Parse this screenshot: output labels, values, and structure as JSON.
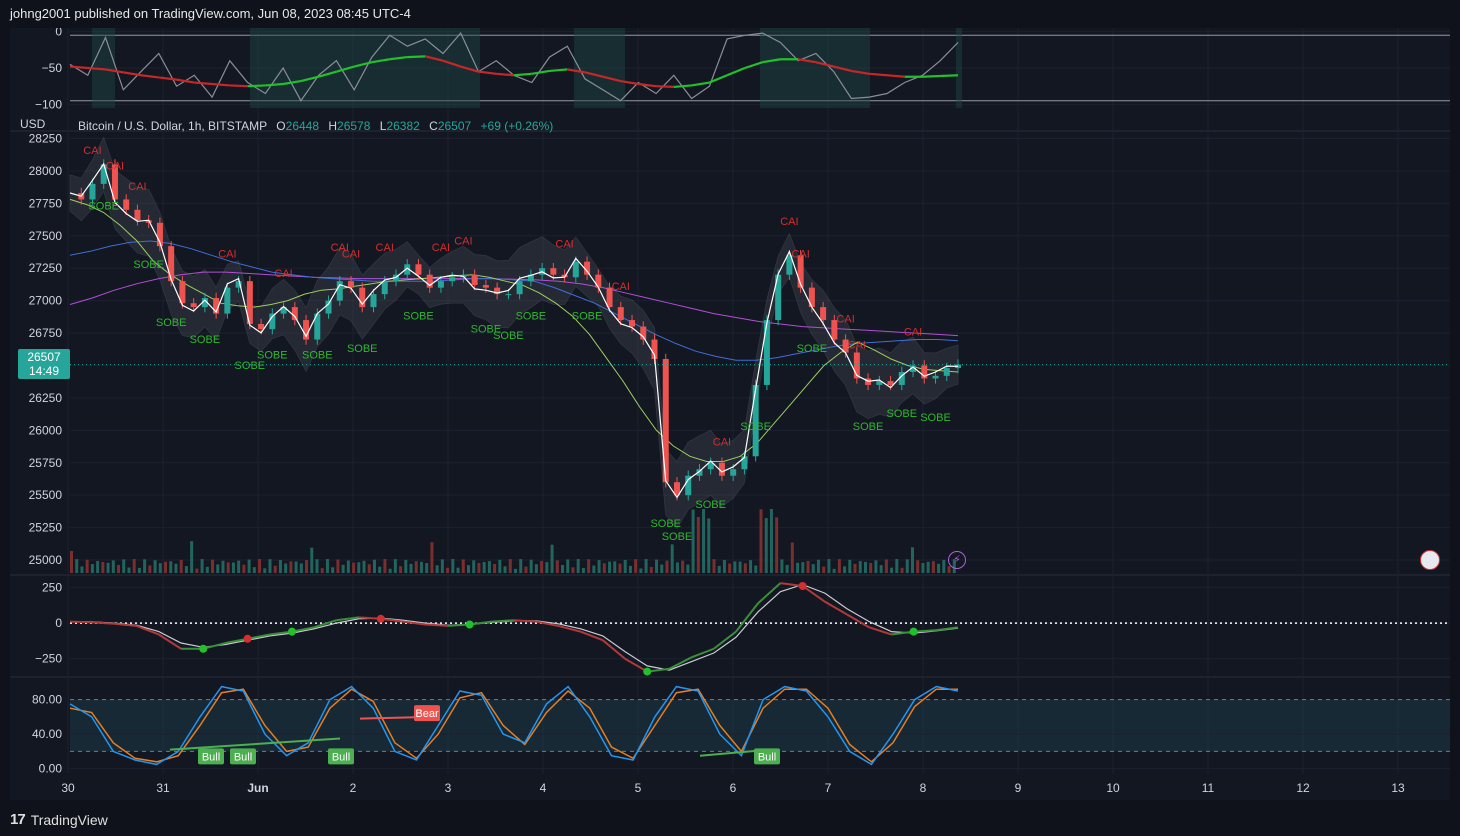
{
  "publisher": "johng2001 published on TradingView.com, Jun 08, 2023 08:45 UTC-4",
  "footer": {
    "brand": "TradingView",
    "logo": "17"
  },
  "symbol": {
    "currency": "USD",
    "name": "Bitcoin / U.S. Dollar, 1h, BITSTAMP",
    "open_label": "O",
    "open": "26448",
    "high_label": "H",
    "high": "26578",
    "low_label": "L",
    "low": "26382",
    "close_label": "C",
    "close": "26507",
    "change": "+69 (+0.26%)"
  },
  "last_price": {
    "price": "26507",
    "countdown": "14:49"
  },
  "colors": {
    "up": "#26a69a",
    "down": "#ef5350",
    "bg": "#131722",
    "grid": "#1e2230"
  },
  "icons": [
    "tradingview-logo-icon",
    "lightning-icon",
    "us-flag-icon"
  ],
  "chart_data": [
    {
      "type": "line",
      "panel": "top-oscillator",
      "yticks": [
        "0",
        "−50",
        "−100"
      ],
      "ylim": [
        -105,
        5
      ],
      "x": [
        0,
        4,
        8,
        12,
        16,
        20,
        24,
        28,
        32,
        36,
        40,
        44,
        48,
        52,
        56,
        60,
        64,
        68,
        72,
        76,
        80,
        84,
        88,
        92,
        96,
        100,
        104,
        108,
        112,
        116,
        120,
        124,
        128,
        132,
        136,
        140,
        144,
        148,
        152,
        156,
        160,
        164,
        168,
        172,
        176,
        180,
        184,
        188,
        192,
        196,
        200
      ],
      "series": [
        {
          "name": "",
          "values": [
            -45,
            -60,
            -8,
            -80,
            -55,
            -30,
            -75,
            -60,
            -90,
            -40,
            -70,
            -85,
            -50,
            -95,
            -60,
            -40,
            -80,
            -35,
            -5,
            -20,
            -10,
            -30,
            -2,
            -55,
            -40,
            -60,
            -70,
            -35,
            -20,
            -65,
            -80,
            -95,
            -70,
            -85,
            -60,
            -92,
            -75,
            -10,
            -5,
            -2,
            -15,
            -40,
            -30,
            -55,
            -92,
            -90,
            -85,
            -70,
            -60,
            -40,
            -15
          ]
        },
        {
          "name": "",
          "values": [
            -48,
            -50,
            -52,
            -56,
            -60,
            -63,
            -66,
            -70,
            -72,
            -74,
            -75,
            -74,
            -72,
            -68,
            -62,
            -55,
            -48,
            -42,
            -38,
            -35,
            -34,
            -40,
            -48,
            -55,
            -58,
            -60,
            -58,
            -54,
            -52,
            -56,
            -62,
            -68,
            -72,
            -75,
            -76,
            -74,
            -70,
            -60,
            -50,
            -42,
            -38,
            -38,
            -42,
            -48,
            -54,
            -58,
            -60,
            -62,
            -62,
            -61,
            -60
          ]
        }
      ]
    },
    {
      "type": "line",
      "panel": "price",
      "title": "Bitcoin / U.S. Dollar, 1h, BITSTAMP",
      "yticks": [
        "28250",
        "28000",
        "27750",
        "27500",
        "27250",
        "27000",
        "26750",
        "26500",
        "26250",
        "26000",
        "25750",
        "25500",
        "25250",
        "25000"
      ],
      "ylim": [
        24900,
        28300
      ],
      "xticks": [
        "30",
        "31",
        "Jun",
        "2",
        "3",
        "4",
        "5",
        "6",
        "7",
        "8",
        "9",
        "10",
        "11",
        "12",
        "13"
      ],
      "series": [
        {
          "name": "",
          "values": [
            27830,
            27780,
            27900,
            28050,
            27780,
            27700,
            27620,
            27600,
            27420,
            27150,
            26980,
            26950,
            27020,
            26900,
            27100,
            27150,
            26820,
            26780,
            26900,
            26950,
            26850,
            26700,
            26900,
            27000,
            27150,
            27100,
            26950,
            27050,
            27150,
            27200,
            27280,
            27200,
            27100,
            27150,
            27180,
            27200,
            27120,
            27100,
            27050,
            27050,
            27150,
            27200,
            27250,
            27200,
            27180,
            27300,
            27200,
            27100,
            26950,
            26850,
            26800,
            26700,
            26550,
            25600,
            25500,
            25650,
            25700,
            25750,
            25650,
            25700,
            25800,
            26350,
            26850,
            27200,
            27350,
            27100,
            26950,
            26850,
            26700,
            26600,
            26400,
            26350,
            26380,
            26350,
            26450,
            26500,
            26400,
            26420,
            26480,
            26507
          ]
        },
        {
          "name": "",
          "values": [
            27780,
            27740,
            27680,
            27580,
            27460,
            27300,
            27200,
            27120,
            27050,
            26980,
            26960,
            26950,
            26970,
            27000,
            27050,
            27080,
            27090,
            27110,
            27130,
            27150,
            27160,
            27170,
            27180,
            27190,
            27200,
            27180,
            27150,
            27120,
            27060,
            26980,
            26880,
            26740,
            26560,
            26380,
            26180,
            26000,
            25880,
            25800,
            25760,
            25760,
            25800,
            25900,
            26050,
            26200,
            26350,
            26500,
            26600,
            26680,
            26620,
            26550,
            26500,
            26470,
            26460,
            26450
          ]
        },
        {
          "name": "",
          "values": [
            27350,
            27380,
            27420,
            27450,
            27460,
            27440,
            27400,
            27350,
            27300,
            27260,
            27220,
            27200,
            27180,
            27170,
            27160,
            27150,
            27150,
            27150,
            27150,
            27160,
            27170,
            27170,
            27160,
            27150,
            27100,
            27040,
            26980,
            26900,
            26820,
            26740,
            26670,
            26610,
            26570,
            26540,
            26540,
            26560,
            26590,
            26620,
            26650,
            26670,
            26680,
            26690,
            26700,
            26700,
            26690
          ]
        },
        {
          "name": "",
          "values": [
            26970,
            27020,
            27080,
            27130,
            27170,
            27200,
            27220,
            27220,
            27210,
            27200,
            27190,
            27180,
            27175,
            27170,
            27170,
            27170,
            27170,
            27170,
            27170,
            27170,
            27165,
            27160,
            27150,
            27130,
            27100,
            27060,
            27020,
            26980,
            26940,
            26900,
            26870,
            26840,
            26820,
            26800,
            26790,
            26780,
            26770,
            26760,
            26750,
            26740,
            26730
          ]
        }
      ],
      "annotations": [
        "CAI",
        "SOBE"
      ]
    },
    {
      "type": "line",
      "panel": "momentum",
      "yticks": [
        "250",
        "0",
        "−250"
      ],
      "ylim": [
        -350,
        330
      ],
      "series": [
        {
          "name": "",
          "values": [
            10,
            5,
            -5,
            -20,
            -80,
            -180,
            -180,
            -140,
            -110,
            -80,
            -60,
            -30,
            20,
            40,
            30,
            10,
            -10,
            -20,
            -10,
            10,
            20,
            10,
            -20,
            -60,
            -120,
            -250,
            -340,
            -320,
            -240,
            -180,
            -60,
            140,
            280,
            260,
            150,
            60,
            -30,
            -80,
            -60,
            -50,
            -30
          ]
        },
        {
          "name": "",
          "values": [
            10,
            8,
            0,
            -15,
            -60,
            -140,
            -170,
            -150,
            -120,
            -90,
            -70,
            -40,
            0,
            30,
            35,
            20,
            0,
            -15,
            -10,
            5,
            15,
            15,
            -5,
            -40,
            -90,
            -200,
            -300,
            -330,
            -270,
            -210,
            -100,
            80,
            220,
            270,
            210,
            100,
            10,
            -60,
            -70,
            -55,
            -35
          ]
        }
      ]
    },
    {
      "type": "line",
      "panel": "stochastic",
      "yticks": [
        "80.00",
        "40.00",
        "0.00"
      ],
      "ylim": [
        -5,
        105
      ],
      "series": [
        {
          "name": "",
          "values": [
            75,
            60,
            20,
            10,
            5,
            20,
            60,
            95,
            90,
            40,
            15,
            30,
            80,
            95,
            70,
            20,
            10,
            50,
            90,
            85,
            40,
            30,
            75,
            95,
            60,
            15,
            10,
            60,
            95,
            90,
            40,
            15,
            80,
            95,
            90,
            60,
            20,
            5,
            40,
            80,
            95,
            90
          ]
        },
        {
          "name": "",
          "values": [
            70,
            65,
            30,
            12,
            8,
            15,
            50,
            88,
            92,
            50,
            20,
            25,
            70,
            92,
            78,
            30,
            12,
            40,
            82,
            88,
            50,
            28,
            65,
            90,
            70,
            25,
            12,
            50,
            88,
            92,
            50,
            20,
            70,
            92,
            92,
            70,
            28,
            8,
            30,
            72,
            92,
            92
          ]
        }
      ],
      "labels": [
        "Bull",
        "Bull",
        "Bull",
        "Bear",
        "Bull"
      ]
    }
  ]
}
